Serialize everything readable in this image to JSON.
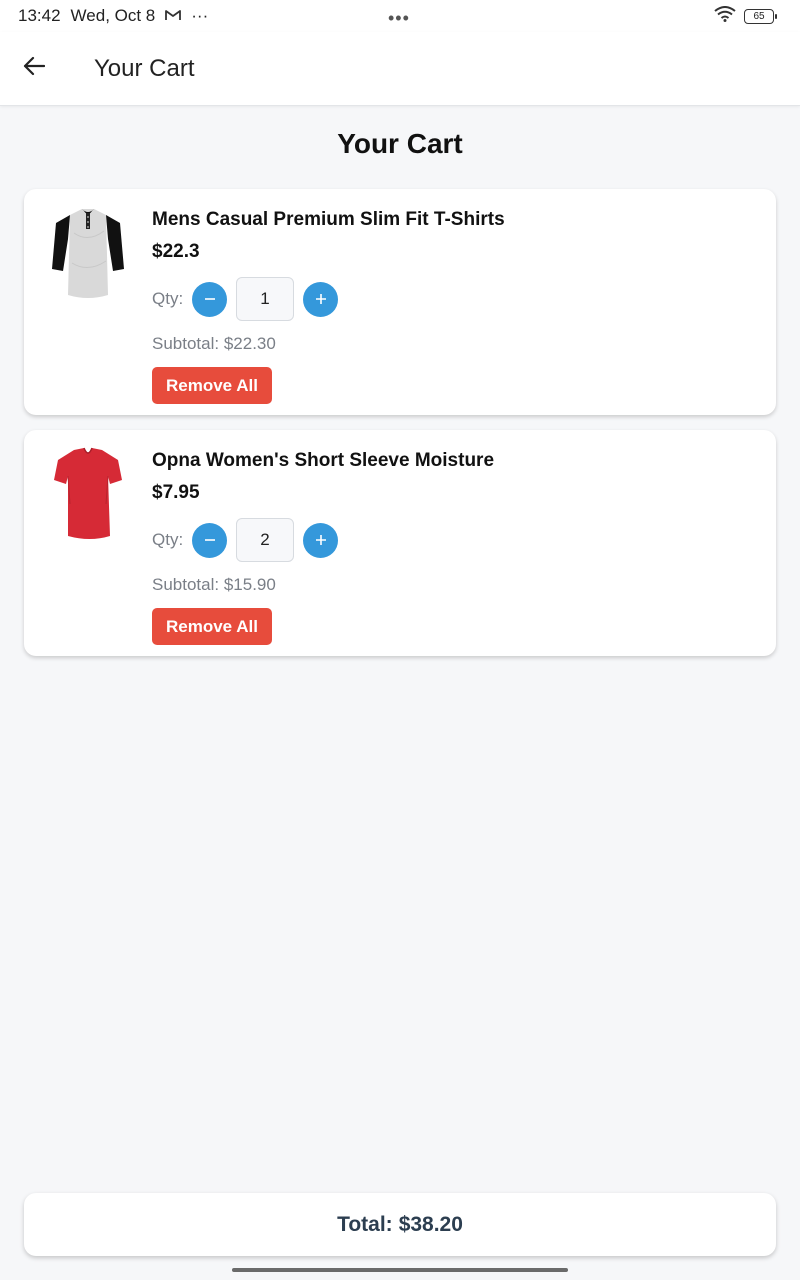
{
  "status_bar": {
    "time": "13:42",
    "date": "Wed, Oct 8",
    "notification_icon": "gmail-icon",
    "more_dots": "···",
    "center_dots": "•••",
    "battery_level": "65"
  },
  "app_bar": {
    "back_icon": "arrow-left-icon",
    "title": "Your Cart"
  },
  "page_title": "Your Cart",
  "cart": {
    "items": [
      {
        "title": "Mens Casual Premium Slim Fit T-Shirts",
        "price": "$22.3",
        "qty_label": "Qty:",
        "quantity": "1",
        "subtotal": "Subtotal: $22.30",
        "remove_label": "Remove All",
        "image_icon": "henley-shirt-image"
      },
      {
        "title": "Opna Women's Short Sleeve Moisture",
        "price": "$7.95",
        "qty_label": "Qty:",
        "quantity": "2",
        "subtotal": "Subtotal: $15.90",
        "remove_label": "Remove All",
        "image_icon": "red-tshirt-image"
      }
    ]
  },
  "total": {
    "label": "Total:",
    "value": "$38.20"
  },
  "colors": {
    "accent_blue": "#3498db",
    "remove_red": "#e74c3c",
    "total_text": "#2c3e50",
    "background": "#f6f7f9"
  }
}
